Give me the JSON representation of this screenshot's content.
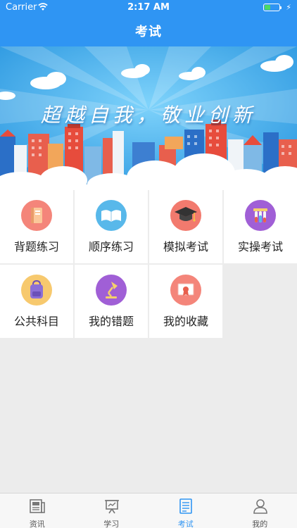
{
  "status_bar": {
    "carrier": "Carrier",
    "time": "2:17 AM"
  },
  "header": {
    "title": "考试"
  },
  "banner": {
    "slogan": "超越自我，敬业创新"
  },
  "grid": {
    "items": [
      {
        "label": "背题练习",
        "icon": "book-icon",
        "color": "#f4857a"
      },
      {
        "label": "顺序练习",
        "icon": "open-book-icon",
        "color": "#58b8ea"
      },
      {
        "label": "模拟考试",
        "icon": "graduation-cap-icon",
        "color": "#f27a6e"
      },
      {
        "label": "实操考试",
        "icon": "test-tubes-icon",
        "color": "#a05fd6"
      },
      {
        "label": "公共科目",
        "icon": "backpack-icon",
        "color": "#f7c96e"
      },
      {
        "label": "我的错题",
        "icon": "desk-lamp-icon",
        "color": "#a05fd6"
      },
      {
        "label": "我的收藏",
        "icon": "certificate-icon",
        "color": "#f4857a"
      }
    ]
  },
  "tabbar": {
    "items": [
      {
        "label": "资讯",
        "icon": "news-icon"
      },
      {
        "label": "学习",
        "icon": "presentation-board-icon"
      },
      {
        "label": "考试",
        "icon": "exam-sheet-icon"
      },
      {
        "label": "我的",
        "icon": "person-icon"
      }
    ],
    "active_color": "#2f95f3"
  }
}
